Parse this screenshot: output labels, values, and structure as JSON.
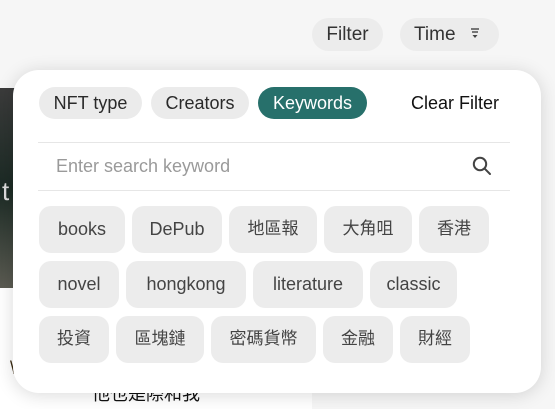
{
  "toolbar": {
    "filter_label": "Filter",
    "time_label": "Time",
    "time_icon": "sort-icon"
  },
  "background": {
    "side_text": "t",
    "bottom_text": "他也是際和我",
    "bottom_mark": "\\"
  },
  "panel": {
    "tabs": [
      {
        "label": "NFT type",
        "active": false
      },
      {
        "label": "Creators",
        "active": false
      },
      {
        "label": "Keywords",
        "active": true
      }
    ],
    "clear_filter_label": "Clear Filter",
    "search": {
      "placeholder": "Enter search keyword",
      "value": "",
      "icon": "search-icon"
    },
    "keywords": [
      "books",
      "DePub",
      "地區報",
      "大角咀",
      "香港",
      "novel",
      "hongkong",
      "literature",
      "classic",
      "投資",
      "區塊鏈",
      "密碼貨幣",
      "金融",
      "財經"
    ]
  },
  "colors": {
    "accent": "#27706b",
    "chip_bg": "#ececec",
    "page_bg": "#f6f6f6"
  }
}
